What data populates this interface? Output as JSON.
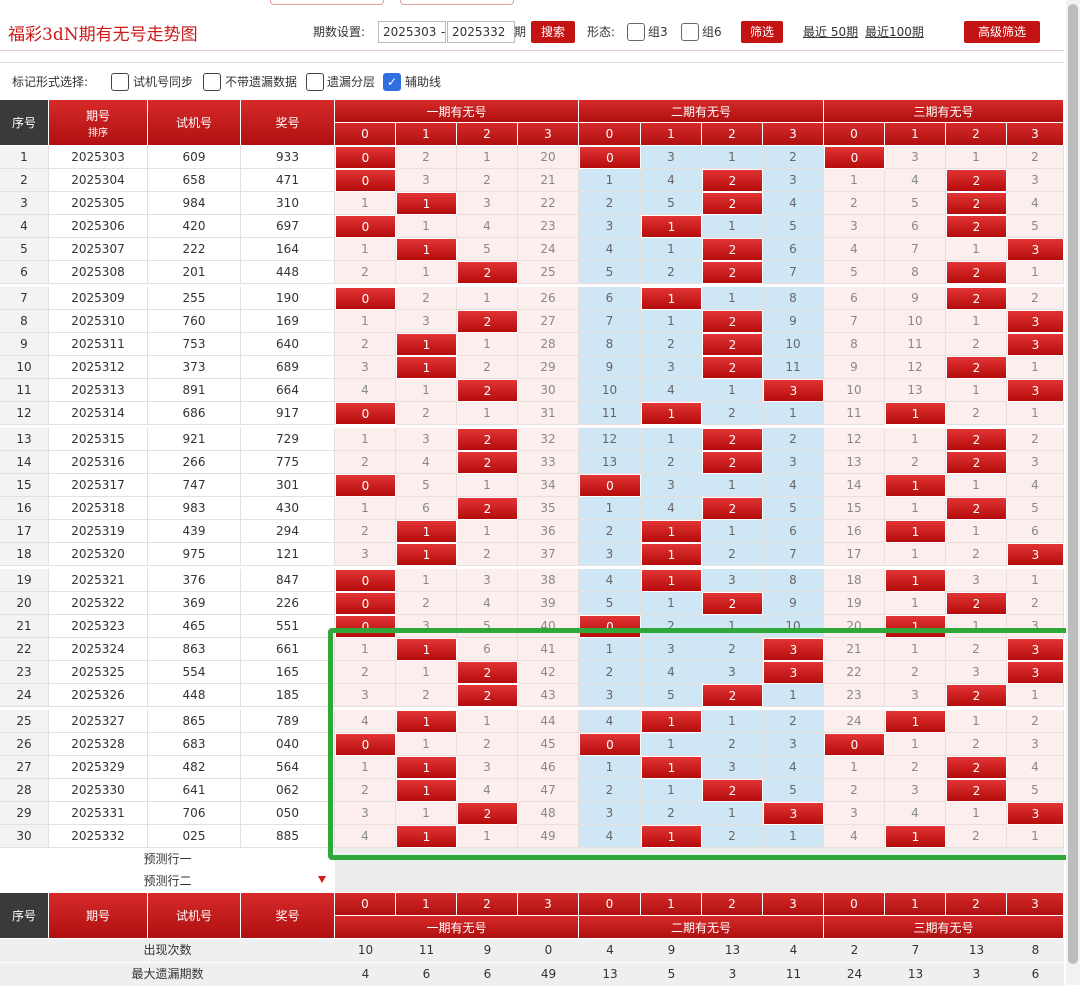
{
  "page": {
    "title": "福彩3dN期有无号走势图",
    "period_label": "期数设置:",
    "period_start": "2025303",
    "dash": "-",
    "period_end": "2025332",
    "period_unit": "期",
    "search_button": "搜索",
    "form_label": "形态:",
    "group3_label": "组3",
    "group6_label": "组6",
    "filter_button": "筛选",
    "recent50": "最近 50期",
    "recent100": "最近100期",
    "advanced_button": "高级筛选"
  },
  "options": {
    "label": "标记形式选择:",
    "items": [
      {
        "label": "试机号同步",
        "checked": false
      },
      {
        "label": "不带遗漏数据",
        "checked": false
      },
      {
        "label": "遗漏分层",
        "checked": false
      },
      {
        "label": "辅助线",
        "checked": true
      }
    ],
    "check_mark": "✓"
  },
  "header": {
    "seq": "序号",
    "period": "期号",
    "sort": "排序",
    "trial": "试机号",
    "prize": "奖号",
    "groups": [
      "一期有无号",
      "二期有无号",
      "三期有无号"
    ],
    "digits": [
      "0",
      "1",
      "2",
      "3"
    ]
  },
  "rows": [
    {
      "seq": "1",
      "period": "2025303",
      "trial": "609",
      "prize": "933",
      "g1": [
        "0",
        "2",
        "1",
        "20"
      ],
      "g2": [
        "0",
        "3",
        "1",
        "2"
      ],
      "g3": [
        "0",
        "3",
        "1",
        "2"
      ],
      "h1": 0,
      "h2": 0,
      "h3": 0
    },
    {
      "seq": "2",
      "period": "2025304",
      "trial": "658",
      "prize": "471",
      "g1": [
        "0",
        "3",
        "2",
        "21"
      ],
      "g2": [
        "1",
        "4",
        "2",
        "3"
      ],
      "g3": [
        "1",
        "4",
        "2",
        "3"
      ],
      "h1": 0,
      "h2": 2,
      "h3": 2
    },
    {
      "seq": "3",
      "period": "2025305",
      "trial": "984",
      "prize": "310",
      "g1": [
        "1",
        "1",
        "3",
        "22"
      ],
      "g2": [
        "2",
        "5",
        "2",
        "4"
      ],
      "g3": [
        "2",
        "5",
        "2",
        "4"
      ],
      "h1": 1,
      "h2": 2,
      "h3": 2
    },
    {
      "seq": "4",
      "period": "2025306",
      "trial": "420",
      "prize": "697",
      "g1": [
        "0",
        "1",
        "4",
        "23"
      ],
      "g2": [
        "3",
        "1",
        "1",
        "5"
      ],
      "g3": [
        "3",
        "6",
        "2",
        "5"
      ],
      "h1": 0,
      "h2": 1,
      "h3": 2
    },
    {
      "seq": "5",
      "period": "2025307",
      "trial": "222",
      "prize": "164",
      "g1": [
        "1",
        "1",
        "5",
        "24"
      ],
      "g2": [
        "4",
        "1",
        "2",
        "6"
      ],
      "g3": [
        "4",
        "7",
        "1",
        "3"
      ],
      "h1": 1,
      "h2": 2,
      "h3": 3
    },
    {
      "seq": "6",
      "period": "2025308",
      "trial": "201",
      "prize": "448",
      "g1": [
        "2",
        "1",
        "2",
        "25"
      ],
      "g2": [
        "5",
        "2",
        "2",
        "7"
      ],
      "g3": [
        "5",
        "8",
        "2",
        "1"
      ],
      "h1": 2,
      "h2": 2,
      "h3": 2
    },
    {
      "seq": "7",
      "period": "2025309",
      "trial": "255",
      "prize": "190",
      "g1": [
        "0",
        "2",
        "1",
        "26"
      ],
      "g2": [
        "6",
        "1",
        "1",
        "8"
      ],
      "g3": [
        "6",
        "9",
        "2",
        "2"
      ],
      "h1": 0,
      "h2": 1,
      "h3": 2
    },
    {
      "seq": "8",
      "period": "2025310",
      "trial": "760",
      "prize": "169",
      "g1": [
        "1",
        "3",
        "2",
        "27"
      ],
      "g2": [
        "7",
        "1",
        "2",
        "9"
      ],
      "g3": [
        "7",
        "10",
        "1",
        "3"
      ],
      "h1": 2,
      "h2": 2,
      "h3": 3
    },
    {
      "seq": "9",
      "period": "2025311",
      "trial": "753",
      "prize": "640",
      "g1": [
        "2",
        "1",
        "1",
        "28"
      ],
      "g2": [
        "8",
        "2",
        "2",
        "10"
      ],
      "g3": [
        "8",
        "11",
        "2",
        "3"
      ],
      "h1": 1,
      "h2": 2,
      "h3": 3
    },
    {
      "seq": "10",
      "period": "2025312",
      "trial": "373",
      "prize": "689",
      "g1": [
        "3",
        "1",
        "2",
        "29"
      ],
      "g2": [
        "9",
        "3",
        "2",
        "11"
      ],
      "g3": [
        "9",
        "12",
        "2",
        "1"
      ],
      "h1": 1,
      "h2": 2,
      "h3": 2
    },
    {
      "seq": "11",
      "period": "2025313",
      "trial": "891",
      "prize": "664",
      "g1": [
        "4",
        "1",
        "2",
        "30"
      ],
      "g2": [
        "10",
        "4",
        "1",
        "3"
      ],
      "g3": [
        "10",
        "13",
        "1",
        "3"
      ],
      "h1": 2,
      "h2": 3,
      "h3": 3
    },
    {
      "seq": "12",
      "period": "2025314",
      "trial": "686",
      "prize": "917",
      "g1": [
        "0",
        "2",
        "1",
        "31"
      ],
      "g2": [
        "11",
        "1",
        "2",
        "1"
      ],
      "g3": [
        "11",
        "1",
        "2",
        "1"
      ],
      "h1": 0,
      "h2": 1,
      "h3": 1
    },
    {
      "seq": "13",
      "period": "2025315",
      "trial": "921",
      "prize": "729",
      "g1": [
        "1",
        "3",
        "2",
        "32"
      ],
      "g2": [
        "12",
        "1",
        "2",
        "2"
      ],
      "g3": [
        "12",
        "1",
        "2",
        "2"
      ],
      "h1": 2,
      "h2": 2,
      "h3": 2
    },
    {
      "seq": "14",
      "period": "2025316",
      "trial": "266",
      "prize": "775",
      "g1": [
        "2",
        "4",
        "2",
        "33"
      ],
      "g2": [
        "13",
        "2",
        "2",
        "3"
      ],
      "g3": [
        "13",
        "2",
        "2",
        "3"
      ],
      "h1": 2,
      "h2": 2,
      "h3": 2
    },
    {
      "seq": "15",
      "period": "2025317",
      "trial": "747",
      "prize": "301",
      "g1": [
        "0",
        "5",
        "1",
        "34"
      ],
      "g2": [
        "0",
        "3",
        "1",
        "4"
      ],
      "g3": [
        "14",
        "1",
        "1",
        "4"
      ],
      "h1": 0,
      "h2": 0,
      "h3": 1
    },
    {
      "seq": "16",
      "period": "2025318",
      "trial": "983",
      "prize": "430",
      "g1": [
        "1",
        "6",
        "2",
        "35"
      ],
      "g2": [
        "1",
        "4",
        "2",
        "5"
      ],
      "g3": [
        "15",
        "1",
        "2",
        "5"
      ],
      "h1": 2,
      "h2": 2,
      "h3": 2
    },
    {
      "seq": "17",
      "period": "2025319",
      "trial": "439",
      "prize": "294",
      "g1": [
        "2",
        "1",
        "1",
        "36"
      ],
      "g2": [
        "2",
        "1",
        "1",
        "6"
      ],
      "g3": [
        "16",
        "1",
        "1",
        "6"
      ],
      "h1": 1,
      "h2": 1,
      "h3": 1
    },
    {
      "seq": "18",
      "period": "2025320",
      "trial": "975",
      "prize": "121",
      "g1": [
        "3",
        "1",
        "2",
        "37"
      ],
      "g2": [
        "3",
        "1",
        "2",
        "7"
      ],
      "g3": [
        "17",
        "1",
        "2",
        "3"
      ],
      "h1": 1,
      "h2": 1,
      "h3": 3
    },
    {
      "seq": "19",
      "period": "2025321",
      "trial": "376",
      "prize": "847",
      "g1": [
        "0",
        "1",
        "3",
        "38"
      ],
      "g2": [
        "4",
        "1",
        "3",
        "8"
      ],
      "g3": [
        "18",
        "1",
        "3",
        "1"
      ],
      "h1": 0,
      "h2": 1,
      "h3": 1
    },
    {
      "seq": "20",
      "period": "2025322",
      "trial": "369",
      "prize": "226",
      "g1": [
        "0",
        "2",
        "4",
        "39"
      ],
      "g2": [
        "5",
        "1",
        "2",
        "9"
      ],
      "g3": [
        "19",
        "1",
        "2",
        "2"
      ],
      "h1": 0,
      "h2": 2,
      "h3": 2
    },
    {
      "seq": "21",
      "period": "2025323",
      "trial": "465",
      "prize": "551",
      "g1": [
        "0",
        "3",
        "5",
        "40"
      ],
      "g2": [
        "0",
        "2",
        "1",
        "10"
      ],
      "g3": [
        "20",
        "1",
        "1",
        "3"
      ],
      "h1": 0,
      "h2": 0,
      "h3": 1
    },
    {
      "seq": "22",
      "period": "2025324",
      "trial": "863",
      "prize": "661",
      "g1": [
        "1",
        "1",
        "6",
        "41"
      ],
      "g2": [
        "1",
        "3",
        "2",
        "3"
      ],
      "g3": [
        "21",
        "1",
        "2",
        "3"
      ],
      "h1": 1,
      "h2": 3,
      "h3": 3
    },
    {
      "seq": "23",
      "period": "2025325",
      "trial": "554",
      "prize": "165",
      "g1": [
        "2",
        "1",
        "2",
        "42"
      ],
      "g2": [
        "2",
        "4",
        "3",
        "3"
      ],
      "g3": [
        "22",
        "2",
        "3",
        "3"
      ],
      "h1": 2,
      "h2": 3,
      "h3": 3
    },
    {
      "seq": "24",
      "period": "2025326",
      "trial": "448",
      "prize": "185",
      "g1": [
        "3",
        "2",
        "2",
        "43"
      ],
      "g2": [
        "3",
        "5",
        "2",
        "1"
      ],
      "g3": [
        "23",
        "3",
        "2",
        "1"
      ],
      "h1": 2,
      "h2": 2,
      "h3": 2
    },
    {
      "seq": "25",
      "period": "2025327",
      "trial": "865",
      "prize": "789",
      "g1": [
        "4",
        "1",
        "1",
        "44"
      ],
      "g2": [
        "4",
        "1",
        "1",
        "2"
      ],
      "g3": [
        "24",
        "1",
        "1",
        "2"
      ],
      "h1": 1,
      "h2": 1,
      "h3": 1
    },
    {
      "seq": "26",
      "period": "2025328",
      "trial": "683",
      "prize": "040",
      "g1": [
        "0",
        "1",
        "2",
        "45"
      ],
      "g2": [
        "0",
        "1",
        "2",
        "3"
      ],
      "g3": [
        "0",
        "1",
        "2",
        "3"
      ],
      "h1": 0,
      "h2": 0,
      "h3": 0
    },
    {
      "seq": "27",
      "period": "2025329",
      "trial": "482",
      "prize": "564",
      "g1": [
        "1",
        "1",
        "3",
        "46"
      ],
      "g2": [
        "1",
        "1",
        "3",
        "4"
      ],
      "g3": [
        "1",
        "2",
        "2",
        "4"
      ],
      "h1": 1,
      "h2": 1,
      "h3": 2
    },
    {
      "seq": "28",
      "period": "2025330",
      "trial": "641",
      "prize": "062",
      "g1": [
        "2",
        "1",
        "4",
        "47"
      ],
      "g2": [
        "2",
        "1",
        "2",
        "5"
      ],
      "g3": [
        "2",
        "3",
        "2",
        "5"
      ],
      "h1": 1,
      "h2": 2,
      "h3": 2
    },
    {
      "seq": "29",
      "period": "2025331",
      "trial": "706",
      "prize": "050",
      "g1": [
        "3",
        "1",
        "2",
        "48"
      ],
      "g2": [
        "3",
        "2",
        "1",
        "3"
      ],
      "g3": [
        "3",
        "4",
        "1",
        "3"
      ],
      "h1": 2,
      "h2": 3,
      "h3": 3
    },
    {
      "seq": "30",
      "period": "2025332",
      "trial": "025",
      "prize": "885",
      "g1": [
        "4",
        "1",
        "1",
        "49"
      ],
      "g2": [
        "4",
        "1",
        "2",
        "1"
      ],
      "g3": [
        "4",
        "1",
        "2",
        "1"
      ],
      "h1": 1,
      "h2": 1,
      "h3": 1
    }
  ],
  "predict": {
    "row1": "预测行一",
    "row2": "预测行二"
  },
  "footer": {
    "appear_label": "出现次数",
    "appear": [
      "10",
      "11",
      "9",
      "0",
      "4",
      "9",
      "13",
      "4",
      "2",
      "7",
      "13",
      "8"
    ],
    "maxmiss_label": "最大遗漏期数",
    "maxmiss": [
      "4",
      "6",
      "6",
      "49",
      "13",
      "5",
      "3",
      "11",
      "24",
      "13",
      "3",
      "6"
    ]
  }
}
